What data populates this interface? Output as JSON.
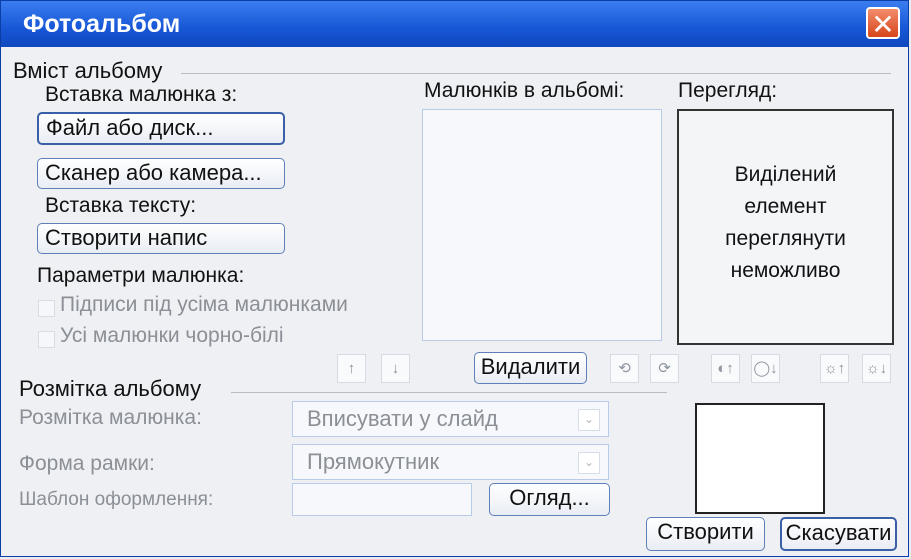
{
  "window": {
    "title": "Фотоальбом",
    "close_symbol": "✕"
  },
  "album_content": {
    "section_title": "Вміст альбому",
    "insert_picture_label": "Вставка малюнка з:",
    "file_or_disk_button": "Файл або диск...",
    "scanner_or_camera_button": "Сканер або камера...",
    "insert_text_label": "Вставка тексту:",
    "create_caption_button": "Створити напис",
    "picture_params_label": "Параметри малюнка:",
    "captions_checkbox_label": "Підписи під усіма малюнками",
    "black_white_checkbox_label": "Усі малюнки чорно-білі",
    "pictures_label": "Малюнків в альбомі:",
    "preview_label": "Перегляд:",
    "preview_message_lines": [
      "Виділений",
      "елемент",
      "переглянути",
      "неможливо"
    ],
    "delete_button": "Видалити",
    "move_up_symbol": "↑",
    "move_down_symbol": "↓",
    "rotate_left_symbol": "⟲",
    "rotate_right_symbol": "⟳",
    "contrast_up_symbol": "◐↑",
    "contrast_down_symbol": "◯↓",
    "brightness_up_symbol": "☼↑",
    "brightness_down_symbol": "☼↓"
  },
  "album_layout": {
    "section_title": "Розмітка альбому",
    "picture_layout_label": "Розмітка малюнка:",
    "picture_layout_value": "Вписувати у слайд",
    "frame_shape_label": "Форма рамки:",
    "frame_shape_value": "Прямокутник",
    "theme_label": "Шаблон оформлення:",
    "browse_button": "Огляд...",
    "dropdown_symbol": "⌄"
  },
  "footer": {
    "create_button": "Створити",
    "cancel_button": "Скасувати"
  }
}
